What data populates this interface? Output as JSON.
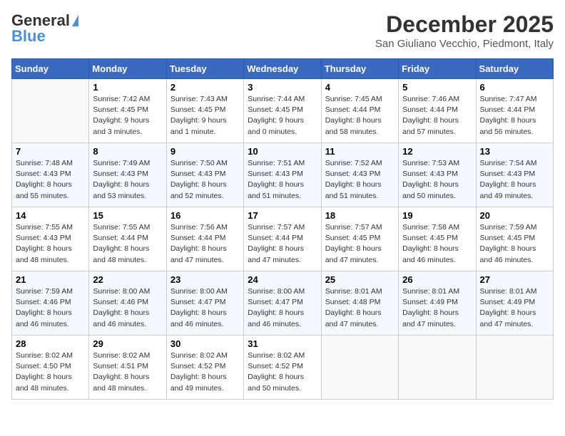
{
  "logo": {
    "general": "General",
    "blue": "Blue"
  },
  "title": "December 2025",
  "location": "San Giuliano Vecchio, Piedmont, Italy",
  "days_of_week": [
    "Sunday",
    "Monday",
    "Tuesday",
    "Wednesday",
    "Thursday",
    "Friday",
    "Saturday"
  ],
  "weeks": [
    [
      {
        "day": "",
        "sunrise": "",
        "sunset": "",
        "daylight": "",
        "empty": true
      },
      {
        "day": "1",
        "sunrise": "Sunrise: 7:42 AM",
        "sunset": "Sunset: 4:45 PM",
        "daylight": "Daylight: 9 hours and 3 minutes."
      },
      {
        "day": "2",
        "sunrise": "Sunrise: 7:43 AM",
        "sunset": "Sunset: 4:45 PM",
        "daylight": "Daylight: 9 hours and 1 minute."
      },
      {
        "day": "3",
        "sunrise": "Sunrise: 7:44 AM",
        "sunset": "Sunset: 4:45 PM",
        "daylight": "Daylight: 9 hours and 0 minutes."
      },
      {
        "day": "4",
        "sunrise": "Sunrise: 7:45 AM",
        "sunset": "Sunset: 4:44 PM",
        "daylight": "Daylight: 8 hours and 58 minutes."
      },
      {
        "day": "5",
        "sunrise": "Sunrise: 7:46 AM",
        "sunset": "Sunset: 4:44 PM",
        "daylight": "Daylight: 8 hours and 57 minutes."
      },
      {
        "day": "6",
        "sunrise": "Sunrise: 7:47 AM",
        "sunset": "Sunset: 4:44 PM",
        "daylight": "Daylight: 8 hours and 56 minutes."
      }
    ],
    [
      {
        "day": "7",
        "sunrise": "Sunrise: 7:48 AM",
        "sunset": "Sunset: 4:43 PM",
        "daylight": "Daylight: 8 hours and 55 minutes."
      },
      {
        "day": "8",
        "sunrise": "Sunrise: 7:49 AM",
        "sunset": "Sunset: 4:43 PM",
        "daylight": "Daylight: 8 hours and 53 minutes."
      },
      {
        "day": "9",
        "sunrise": "Sunrise: 7:50 AM",
        "sunset": "Sunset: 4:43 PM",
        "daylight": "Daylight: 8 hours and 52 minutes."
      },
      {
        "day": "10",
        "sunrise": "Sunrise: 7:51 AM",
        "sunset": "Sunset: 4:43 PM",
        "daylight": "Daylight: 8 hours and 51 minutes."
      },
      {
        "day": "11",
        "sunrise": "Sunrise: 7:52 AM",
        "sunset": "Sunset: 4:43 PM",
        "daylight": "Daylight: 8 hours and 51 minutes."
      },
      {
        "day": "12",
        "sunrise": "Sunrise: 7:53 AM",
        "sunset": "Sunset: 4:43 PM",
        "daylight": "Daylight: 8 hours and 50 minutes."
      },
      {
        "day": "13",
        "sunrise": "Sunrise: 7:54 AM",
        "sunset": "Sunset: 4:43 PM",
        "daylight": "Daylight: 8 hours and 49 minutes."
      }
    ],
    [
      {
        "day": "14",
        "sunrise": "Sunrise: 7:55 AM",
        "sunset": "Sunset: 4:43 PM",
        "daylight": "Daylight: 8 hours and 48 minutes."
      },
      {
        "day": "15",
        "sunrise": "Sunrise: 7:55 AM",
        "sunset": "Sunset: 4:44 PM",
        "daylight": "Daylight: 8 hours and 48 minutes."
      },
      {
        "day": "16",
        "sunrise": "Sunrise: 7:56 AM",
        "sunset": "Sunset: 4:44 PM",
        "daylight": "Daylight: 8 hours and 47 minutes."
      },
      {
        "day": "17",
        "sunrise": "Sunrise: 7:57 AM",
        "sunset": "Sunset: 4:44 PM",
        "daylight": "Daylight: 8 hours and 47 minutes."
      },
      {
        "day": "18",
        "sunrise": "Sunrise: 7:57 AM",
        "sunset": "Sunset: 4:45 PM",
        "daylight": "Daylight: 8 hours and 47 minutes."
      },
      {
        "day": "19",
        "sunrise": "Sunrise: 7:58 AM",
        "sunset": "Sunset: 4:45 PM",
        "daylight": "Daylight: 8 hours and 46 minutes."
      },
      {
        "day": "20",
        "sunrise": "Sunrise: 7:59 AM",
        "sunset": "Sunset: 4:45 PM",
        "daylight": "Daylight: 8 hours and 46 minutes."
      }
    ],
    [
      {
        "day": "21",
        "sunrise": "Sunrise: 7:59 AM",
        "sunset": "Sunset: 4:46 PM",
        "daylight": "Daylight: 8 hours and 46 minutes."
      },
      {
        "day": "22",
        "sunrise": "Sunrise: 8:00 AM",
        "sunset": "Sunset: 4:46 PM",
        "daylight": "Daylight: 8 hours and 46 minutes."
      },
      {
        "day": "23",
        "sunrise": "Sunrise: 8:00 AM",
        "sunset": "Sunset: 4:47 PM",
        "daylight": "Daylight: 8 hours and 46 minutes."
      },
      {
        "day": "24",
        "sunrise": "Sunrise: 8:00 AM",
        "sunset": "Sunset: 4:47 PM",
        "daylight": "Daylight: 8 hours and 46 minutes."
      },
      {
        "day": "25",
        "sunrise": "Sunrise: 8:01 AM",
        "sunset": "Sunset: 4:48 PM",
        "daylight": "Daylight: 8 hours and 47 minutes."
      },
      {
        "day": "26",
        "sunrise": "Sunrise: 8:01 AM",
        "sunset": "Sunset: 4:49 PM",
        "daylight": "Daylight: 8 hours and 47 minutes."
      },
      {
        "day": "27",
        "sunrise": "Sunrise: 8:01 AM",
        "sunset": "Sunset: 4:49 PM",
        "daylight": "Daylight: 8 hours and 47 minutes."
      }
    ],
    [
      {
        "day": "28",
        "sunrise": "Sunrise: 8:02 AM",
        "sunset": "Sunset: 4:50 PM",
        "daylight": "Daylight: 8 hours and 48 minutes."
      },
      {
        "day": "29",
        "sunrise": "Sunrise: 8:02 AM",
        "sunset": "Sunset: 4:51 PM",
        "daylight": "Daylight: 8 hours and 48 minutes."
      },
      {
        "day": "30",
        "sunrise": "Sunrise: 8:02 AM",
        "sunset": "Sunset: 4:52 PM",
        "daylight": "Daylight: 8 hours and 49 minutes."
      },
      {
        "day": "31",
        "sunrise": "Sunrise: 8:02 AM",
        "sunset": "Sunset: 4:52 PM",
        "daylight": "Daylight: 8 hours and 50 minutes."
      },
      {
        "day": "",
        "sunrise": "",
        "sunset": "",
        "daylight": "",
        "empty": true
      },
      {
        "day": "",
        "sunrise": "",
        "sunset": "",
        "daylight": "",
        "empty": true
      },
      {
        "day": "",
        "sunrise": "",
        "sunset": "",
        "daylight": "",
        "empty": true
      }
    ]
  ]
}
